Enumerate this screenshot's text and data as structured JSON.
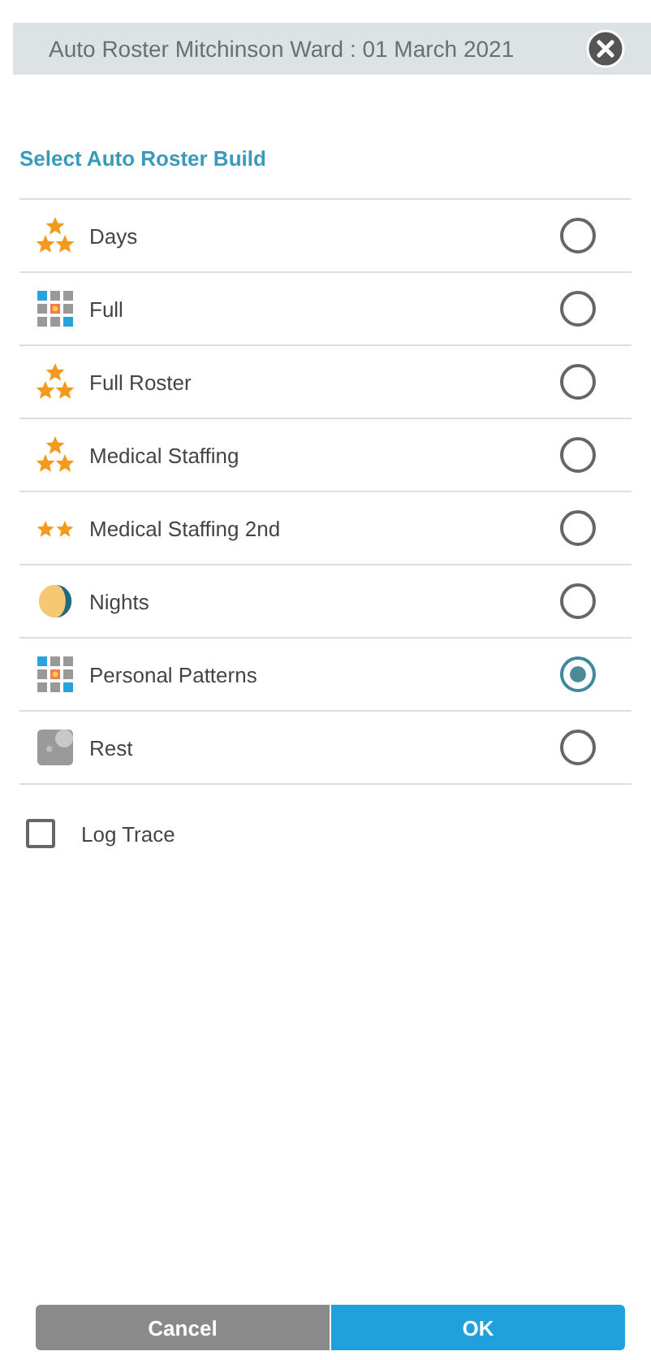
{
  "header": {
    "title": "Auto Roster Mitchinson Ward : 01 March 2021"
  },
  "section_title": "Select Auto Roster Build",
  "options": [
    {
      "label": "Days",
      "kind": "stars3",
      "selected": false
    },
    {
      "label": "Full",
      "kind": "grid",
      "selected": false
    },
    {
      "label": "Full Roster",
      "kind": "stars3",
      "selected": false
    },
    {
      "label": "Medical Staffing",
      "kind": "stars3",
      "selected": false
    },
    {
      "label": "Medical Staffing 2nd",
      "kind": "stars2",
      "selected": false
    },
    {
      "label": "Nights",
      "kind": "moon",
      "selected": false
    },
    {
      "label": "Personal Patterns",
      "kind": "grid",
      "selected": true
    },
    {
      "label": "Rest",
      "kind": "rest",
      "selected": false
    }
  ],
  "log_trace": {
    "label": "Log Trace",
    "checked": false
  },
  "buttons": [
    {
      "label": "Cancel",
      "kind": "cancel"
    },
    {
      "label": "OK",
      "kind": "ok"
    }
  ]
}
